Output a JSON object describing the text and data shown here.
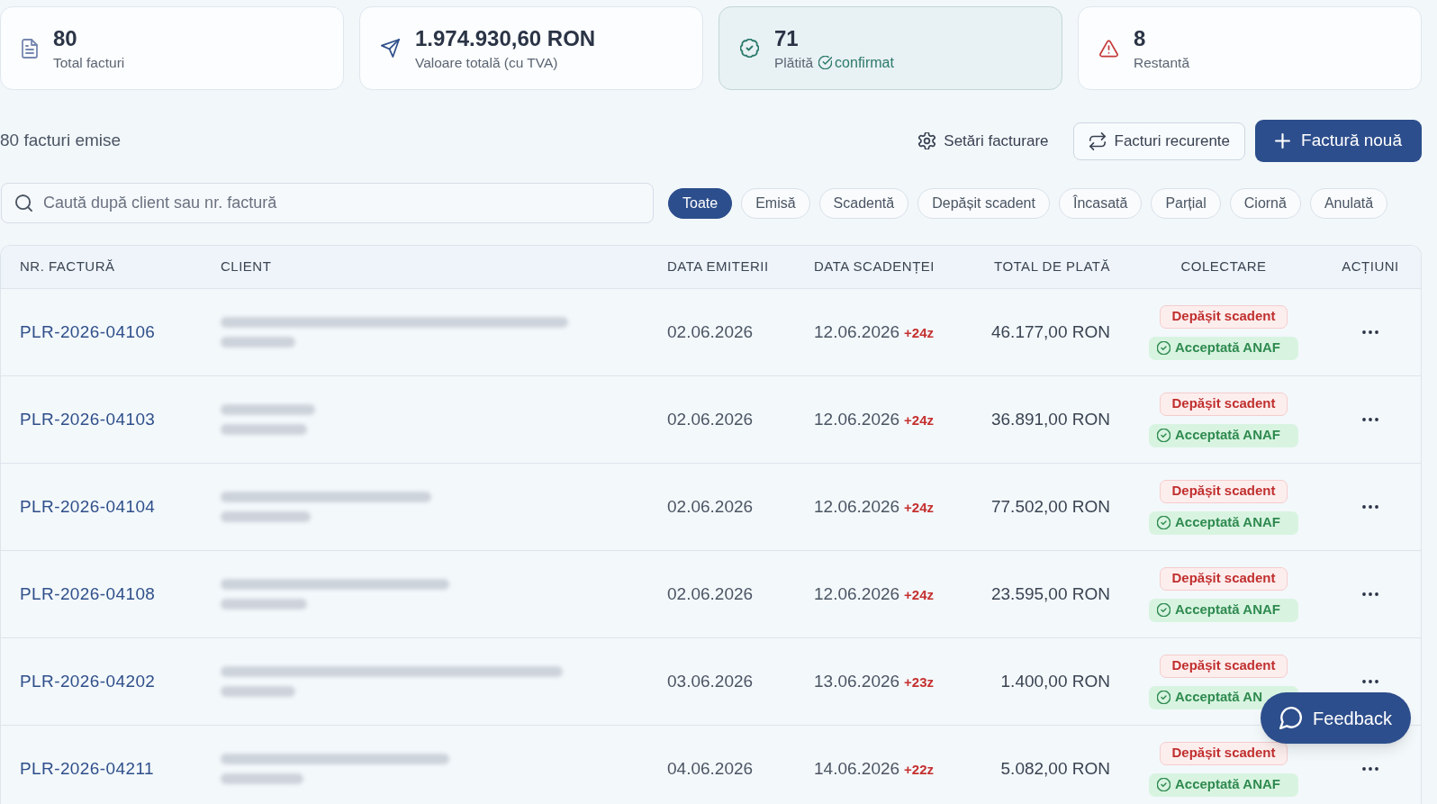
{
  "cards": [
    {
      "kind": "total",
      "value": "80",
      "label": "Total facturi",
      "selected": false
    },
    {
      "kind": "value",
      "value": "1.974.930,60 RON",
      "label": "Valoare totală (cu TVA)",
      "selected": false
    },
    {
      "kind": "paid",
      "value": "71",
      "label": "Plătită",
      "note": "confirmat",
      "selected": true
    },
    {
      "kind": "overdue",
      "value": "8",
      "label": "Restantă",
      "selected": false
    }
  ],
  "toolbar": {
    "count": "80 facturi emise",
    "settings_button": "Setări facturare",
    "recurring_button": "Facturi recurente",
    "new_invoice_button": "Factură nouă"
  },
  "search": {
    "placeholder": "Caută după client sau nr. factură"
  },
  "filters": [
    {
      "label": "Toate",
      "selected": true
    },
    {
      "label": "Emisă",
      "selected": false
    },
    {
      "label": "Scadentă",
      "selected": false
    },
    {
      "label": "Depășit scadent",
      "selected": false
    },
    {
      "label": "Încasată",
      "selected": false
    },
    {
      "label": "Parțial",
      "selected": false
    },
    {
      "label": "Ciornă",
      "selected": false
    },
    {
      "label": "Anulată",
      "selected": false
    }
  ],
  "table": {
    "columns": [
      "NR. FACTURĂ",
      "CLIENT",
      "DATA EMITERII",
      "DATA SCADENȚEI",
      "TOTAL DE PLATĂ",
      "COLECTARE",
      "ACȚIUNI"
    ],
    "rows": [
      {
        "invoice": "PLR-2026-04106",
        "issue_date": "02.06.2026",
        "due_date": "12.06.2026",
        "overdue_days": "+24z",
        "total": "46.177,00 RON",
        "statuses": [
          {
            "kind": "overdue",
            "text": "Depășit scadent"
          },
          {
            "kind": "anaf_accepted",
            "text": "Acceptată ANAF"
          }
        ]
      },
      {
        "invoice": "PLR-2026-04103",
        "issue_date": "02.06.2026",
        "due_date": "12.06.2026",
        "overdue_days": "+24z",
        "total": "36.891,00 RON",
        "statuses": [
          {
            "kind": "overdue",
            "text": "Depășit scadent"
          },
          {
            "kind": "anaf_accepted",
            "text": "Acceptată ANAF"
          }
        ]
      },
      {
        "invoice": "PLR-2026-04104",
        "issue_date": "02.06.2026",
        "due_date": "12.06.2026",
        "overdue_days": "+24z",
        "total": "77.502,00 RON",
        "statuses": [
          {
            "kind": "overdue",
            "text": "Depășit scadent"
          },
          {
            "kind": "anaf_accepted",
            "text": "Acceptată ANAF"
          }
        ]
      },
      {
        "invoice": "PLR-2026-04108",
        "issue_date": "02.06.2026",
        "due_date": "12.06.2026",
        "overdue_days": "+24z",
        "total": "23.595,00 RON",
        "statuses": [
          {
            "kind": "overdue",
            "text": "Depășit scadent"
          },
          {
            "kind": "anaf_accepted",
            "text": "Acceptată ANAF"
          }
        ]
      },
      {
        "invoice": "PLR-2026-04202",
        "issue_date": "03.06.2026",
        "due_date": "13.06.2026",
        "overdue_days": "+23z",
        "total": "1.400,00 RON",
        "statuses": [
          {
            "kind": "overdue",
            "text": "Depășit scadent"
          },
          {
            "kind": "anaf_accepted",
            "text": "Acceptată AN"
          }
        ]
      },
      {
        "invoice": "PLR-2026-04211",
        "issue_date": "04.06.2026",
        "due_date": "14.06.2026",
        "overdue_days": "+22z",
        "total": "5.082,00 RON",
        "statuses": [
          {
            "kind": "overdue",
            "text": "Depășit scadent"
          },
          {
            "kind": "anaf_accepted",
            "text": "Acceptată ANAF"
          }
        ]
      }
    ]
  },
  "feedback_button": "Feedback"
}
